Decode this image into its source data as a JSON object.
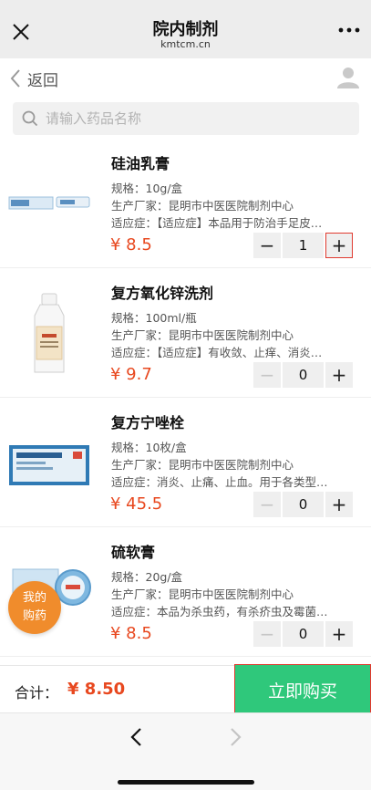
{
  "titlebar": {
    "title": "院内制剂",
    "subtitle": "kmtcm.cn"
  },
  "navbar": {
    "back_label": "返回"
  },
  "search": {
    "placeholder": "请输入药品名称"
  },
  "products": [
    {
      "name": "硅油乳膏",
      "spec": "规格：10g/盒",
      "maker": "生产厂家：昆明市中医医院制剂中心",
      "indication": "适应症：【适应症】本品用于防治手足皮…",
      "price": "¥ 8.5",
      "qty": "1"
    },
    {
      "name": "复方氧化锌洗剂",
      "spec": "规格：100ml/瓶",
      "maker": "生产厂家：昆明市中医医院制剂中心",
      "indication": "适应症：【适应症】有收敛、止痒、消炎…",
      "price": "¥ 9.7",
      "qty": "0"
    },
    {
      "name": "复方宁唑栓",
      "spec": "规格：10枚/盒",
      "maker": "生产厂家：昆明市中医医院制剂中心",
      "indication": "适应症：消炎、止痛、止血。用于各类型…",
      "price": "¥ 45.5",
      "qty": "0"
    },
    {
      "name": "硫软膏",
      "spec": "规格：20g/盒",
      "maker": "生产厂家：昆明市中医医院制剂中心",
      "indication": "适应症：本品为杀虫药，有杀疥虫及霉菌…",
      "price": "¥ 8.5",
      "qty": "0"
    }
  ],
  "stepper": {
    "minus": "−",
    "plus": "+"
  },
  "fab": {
    "line1": "我的",
    "line2": "购药"
  },
  "cart": {
    "total_label": "合计：",
    "total": "¥ 8.50",
    "buy_label": "立即购买"
  },
  "icons": {
    "close": "close-icon",
    "more": "more-icon",
    "back": "chevron-left-icon",
    "user": "user-icon",
    "search": "search-icon",
    "forward": "chevron-right-icon"
  },
  "colors": {
    "price": "#e8481f",
    "buy": "#2fc87b",
    "fab": "#f08c2c",
    "highlight": "#e03a2f"
  }
}
